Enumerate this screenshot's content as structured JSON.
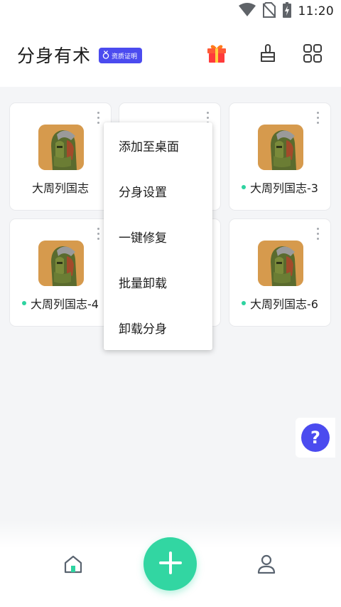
{
  "status_bar": {
    "time": "11:20",
    "icons": [
      "wifi-icon",
      "no-sim-icon",
      "battery-charging-icon"
    ]
  },
  "header": {
    "title": "分身有术",
    "badge_label": "资质证明",
    "actions": [
      "gift-icon",
      "cleanup-brush-icon",
      "grid-view-icon"
    ]
  },
  "apps": [
    {
      "label": "大周列国志",
      "online": false
    },
    {
      "label": "",
      "online": false
    },
    {
      "label": "大周列国志-3",
      "online": true
    },
    {
      "label": "大周列国志-4",
      "online": true
    },
    {
      "label": "",
      "online": false
    },
    {
      "label": "大周列国志-6",
      "online": true
    }
  ],
  "context_menu": {
    "items": [
      "添加至桌面",
      "分身设置",
      "一键修复",
      "批量卸载",
      "卸载分身"
    ]
  },
  "help_button": {
    "label": "?"
  },
  "bottom_nav": {
    "items": [
      "home-icon",
      "add-icon",
      "profile-icon"
    ]
  },
  "colors": {
    "accent_purple": "#4b4bef",
    "accent_green": "#32d6a2",
    "background": "#f4f5f7"
  }
}
